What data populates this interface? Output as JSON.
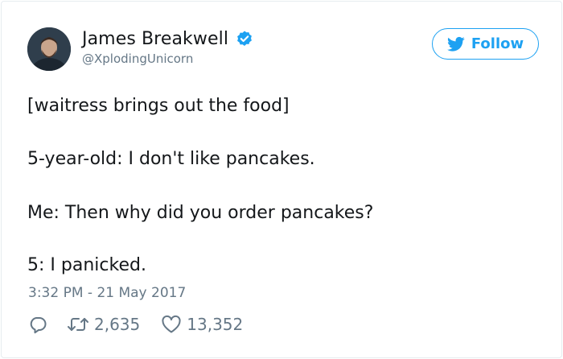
{
  "user": {
    "name": "James Breakwell",
    "handle": "@XplodingUnicorn"
  },
  "follow_button": {
    "label": "Follow"
  },
  "tweet": {
    "lines": [
      "[waitress brings out the food]",
      "5-year-old: I don't like pancakes.",
      "Me: Then why did you order pancakes?",
      "5: I panicked."
    ],
    "timestamp": "3:32 PM - 21 May 2017"
  },
  "actions": {
    "retweets": "2,635",
    "likes": "13,352"
  },
  "icons": {
    "verified": "verified-badge-icon",
    "follow": "twitter-bird-icon",
    "reply": "reply-icon",
    "retweet": "retweet-icon",
    "like": "heart-icon"
  },
  "colors": {
    "accent": "#1da1f2",
    "muted": "#657786",
    "text": "#14171a"
  }
}
